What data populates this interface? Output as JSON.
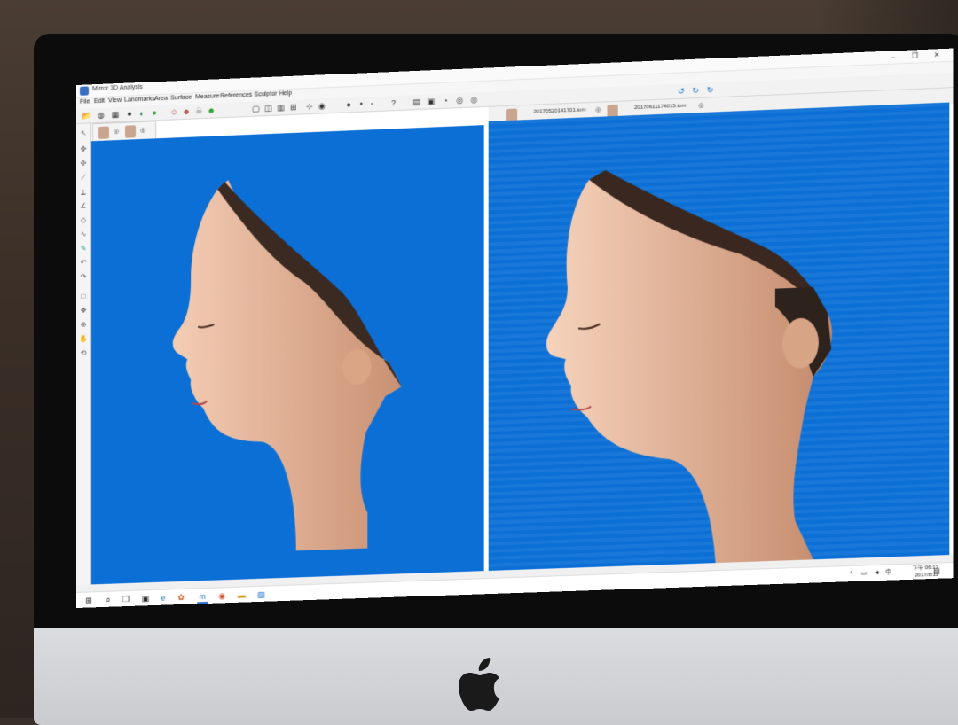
{
  "window": {
    "title": "Mirror 3D Analysis"
  },
  "menu": [
    "File",
    "Edit",
    "View",
    "Landmarks",
    "Area",
    "Surface",
    "Measure",
    "References",
    "Sculptor",
    "Help"
  ],
  "tabs": [
    {
      "label": "20170520141701.tom"
    },
    {
      "label": "20170611174015.tom"
    }
  ],
  "taskbar": {
    "time": "下午 06:13",
    "date": "2017/8/11",
    "ime": "中"
  },
  "colors": {
    "viewport_background": "#0b6fd6",
    "accent": "#3a6fc0"
  },
  "icons": [
    "windows-start-icon",
    "search-icon",
    "task-view-icon",
    "store-icon",
    "edge-icon",
    "mirror-app-icon",
    "chrome-icon",
    "file-explorer-icon",
    "photos-icon",
    "notification-icon"
  ]
}
